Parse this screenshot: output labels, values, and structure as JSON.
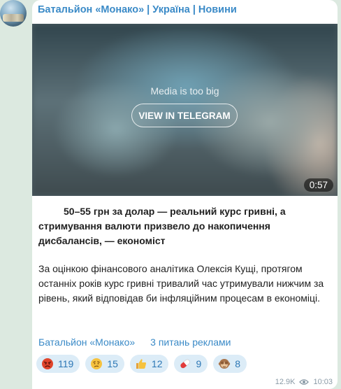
{
  "channel": {
    "name": "Батальйон «Монако» | Україна | Новини"
  },
  "media": {
    "notice": "Media is too big",
    "button_label": "VIEW IN TELEGRAM",
    "duration": "0:57"
  },
  "post": {
    "headline": "50–55 грн за долар — реальний курс гривні, а стримування валюти призвело до накопичення дисбалансів, — економіст",
    "body": "За оцінкою фінансового аналітика Олексія Кущі, протягом останніх років курс гривні тривалий час утримували нижчим за рівень, який відповідав би інфляційним процесам в економіці.",
    "links": [
      {
        "label": "Батальйон «Монако»"
      },
      {
        "label": "3 питань реклами"
      }
    ]
  },
  "reactions": [
    {
      "icon": "angry-face-icon",
      "count": "119"
    },
    {
      "icon": "worried-face-icon",
      "count": "15"
    },
    {
      "icon": "thumbs-up-icon",
      "count": "12"
    },
    {
      "icon": "pill-icon",
      "count": "9"
    },
    {
      "icon": "see-no-evil-monkey-icon",
      "count": "8"
    }
  ],
  "meta": {
    "views": "12.9K",
    "time": "10:03"
  },
  "colors": {
    "link": "#3a8ac7",
    "reaction_bg": "#dcecf7",
    "page_bg": "#dce9e0"
  }
}
